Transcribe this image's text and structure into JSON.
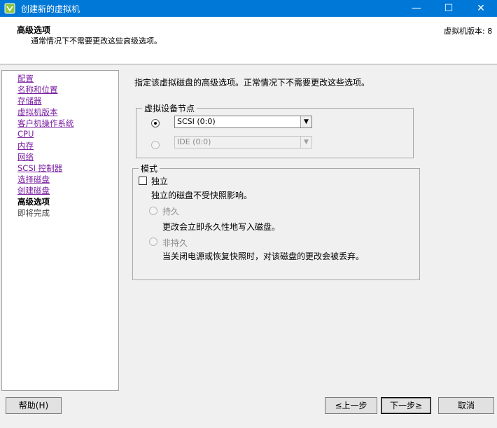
{
  "window": {
    "title": "创建新的虚拟机",
    "min_glyph": "—",
    "max_glyph": "☐",
    "close_glyph": "✕"
  },
  "header": {
    "title": "高级选项",
    "subtitle": "通常情况下不需要更改这些高级选项。",
    "version": "虚拟机版本: 8"
  },
  "nav": {
    "items": [
      {
        "label": "配置"
      },
      {
        "label": "名称和位置"
      },
      {
        "label": "存储器"
      },
      {
        "label": "虚拟机版本"
      },
      {
        "label": "客户机操作系统"
      },
      {
        "label": "CPU"
      },
      {
        "label": "内存"
      },
      {
        "label": "网络"
      },
      {
        "label": "SCSI 控制器"
      },
      {
        "label": "选择磁盘"
      },
      {
        "label": "创建磁盘"
      },
      {
        "label": "高级选项"
      },
      {
        "label": "即将完成"
      }
    ]
  },
  "main": {
    "intro": "指定该虚拟磁盘的高级选项。正常情况下不需要更改这些选项。",
    "device_node": {
      "legend": "虚拟设备节点",
      "scsi_value": "SCSI (0:0)",
      "ide_value": "IDE (0:0)",
      "arrow_glyph": "▼"
    },
    "mode": {
      "legend": "模式",
      "independent_label": "独立",
      "independent_desc": "独立的磁盘不受快照影响。",
      "persistent_label": "持久",
      "persistent_desc": "更改会立即永久性地写入磁盘。",
      "nonpersistent_label": "非持久",
      "nonpersistent_desc": "当关闭电源或恢复快照时，对该磁盘的更改会被丢弃。"
    }
  },
  "footer": {
    "help": "帮助(H)",
    "back": "≤上一步",
    "next": "下一步≥",
    "cancel": "取消"
  }
}
